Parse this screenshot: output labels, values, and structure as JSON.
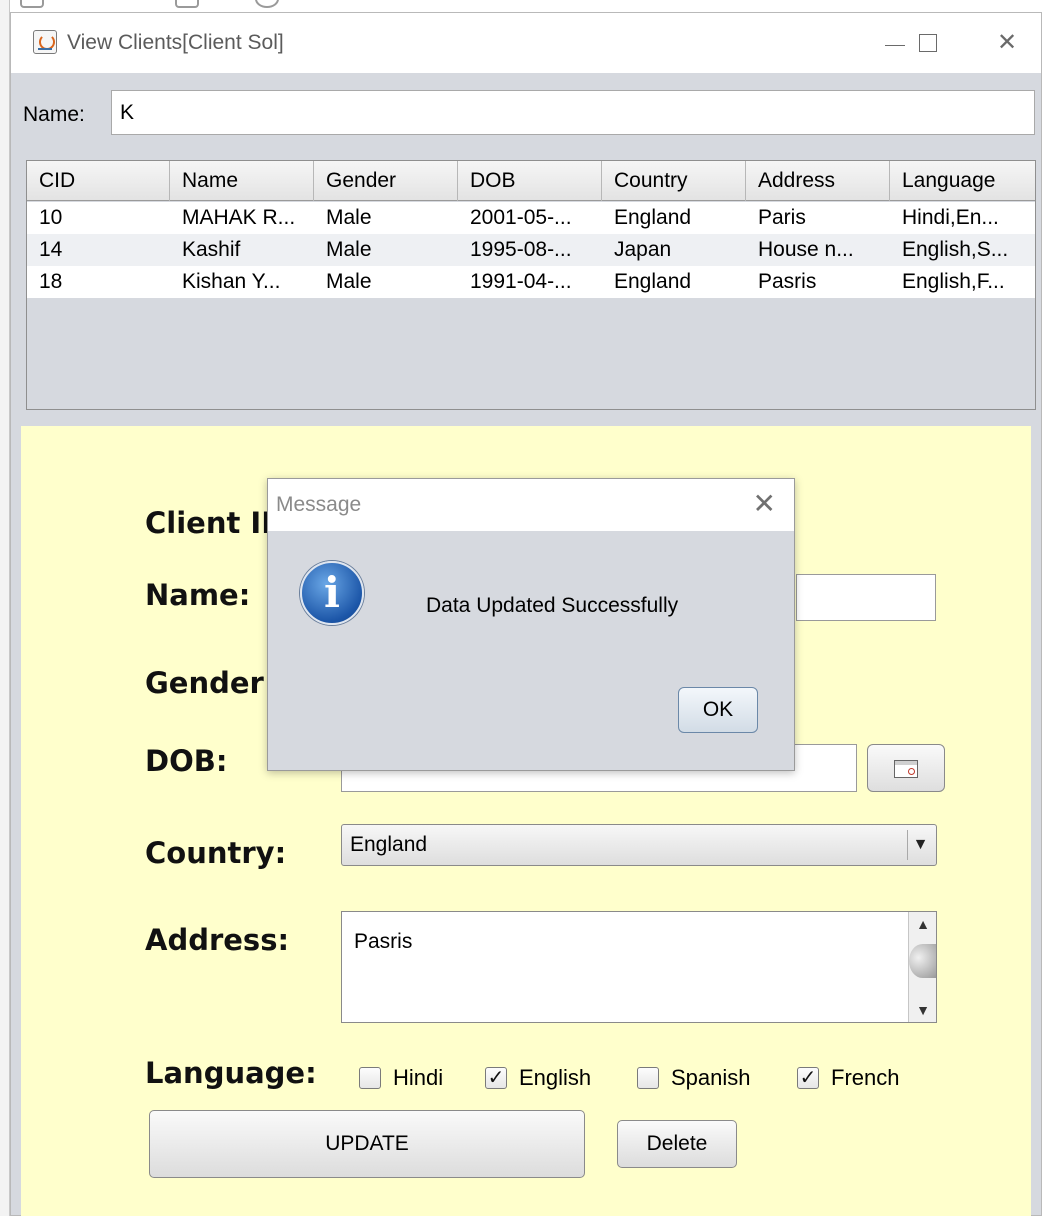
{
  "window": {
    "title": "View Clients[Client Sol]",
    "controls": {
      "close_glyph": "✕"
    }
  },
  "filter": {
    "label": "Name:",
    "value": "K"
  },
  "table": {
    "columns": [
      "CID",
      "Name",
      "Gender",
      "DOB",
      "Country",
      "Address",
      "Language"
    ],
    "rows": [
      [
        "10",
        "MAHAK R...",
        "Male",
        "2001-05-...",
        "England",
        "Paris",
        "Hindi,En..."
      ],
      [
        "14",
        "Kashif",
        "Male",
        "1995-08-...",
        "Japan",
        "House n...",
        "English,S..."
      ],
      [
        "18",
        "Kishan Y...",
        "Male",
        "1991-04-...",
        "England",
        "Pasris",
        "English,F..."
      ]
    ]
  },
  "form": {
    "client_id_label": "Client II",
    "name_label": "Name:",
    "gender_label": "Gender",
    "dob_label": "DOB:",
    "country_label": "Country:",
    "country_value": "England",
    "address_label": "Address:",
    "address_value": "Pasris",
    "language_label": "Language:",
    "languages": [
      {
        "label": "Hindi",
        "checked": false
      },
      {
        "label": "English",
        "checked": true
      },
      {
        "label": "Spanish",
        "checked": false
      },
      {
        "label": "French",
        "checked": true
      }
    ],
    "check_glyph": "✓",
    "update_label": "UPDATE",
    "delete_label": "Delete"
  },
  "dialog": {
    "title": "Message",
    "message": "Data Updated Successfully",
    "ok_label": "OK",
    "icon_glyph": "i",
    "close_glyph": "✕"
  },
  "icons": {
    "combo_arrow": "▼",
    "scroll_up": "▲",
    "scroll_down": "▼"
  }
}
